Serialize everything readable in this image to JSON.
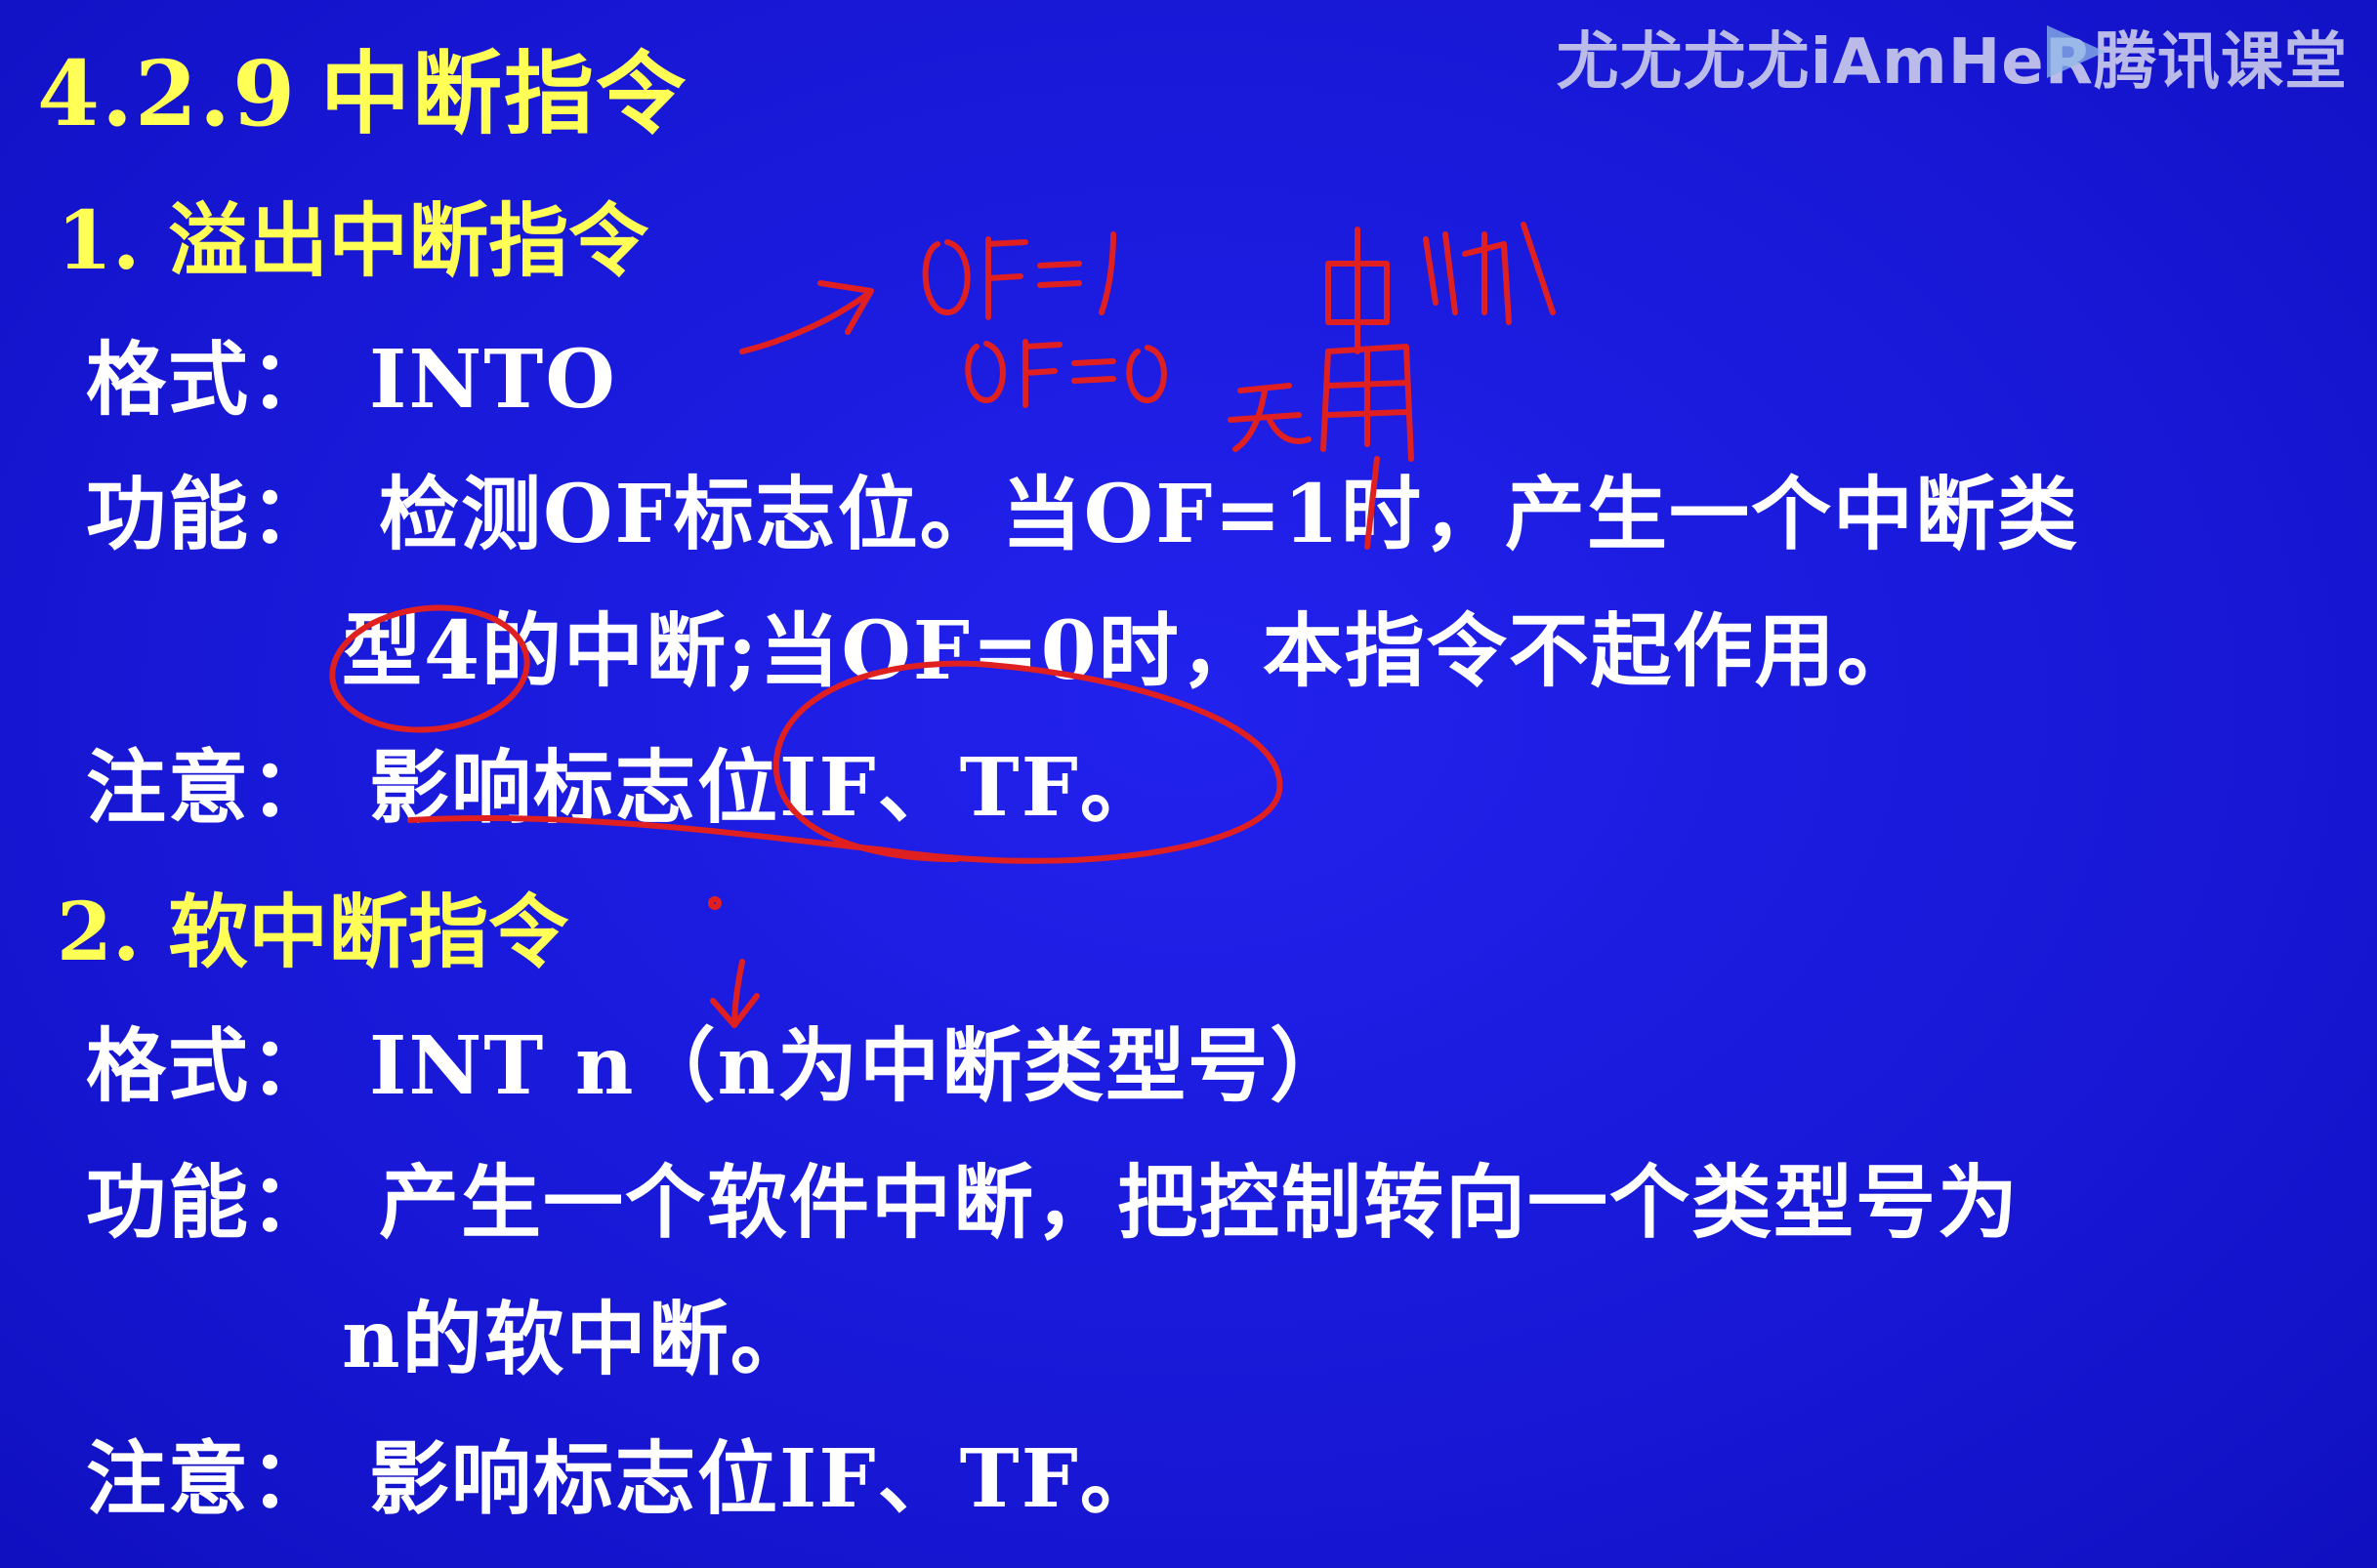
{
  "watermark": "尤尤尤尤iAmHeR腾讯课堂",
  "title": {
    "number": "4.2.9",
    "text": "中断指令"
  },
  "sec1": {
    "heading": "1.  溢出中断指令",
    "format_label": "格式：",
    "format_value": "INTO",
    "func_label": "功能：",
    "func_line1": "检测OF标志位。当OF=1时，产生一个中断类",
    "func_line2": "型4的中断;当OF=0时，本指令不起作用。",
    "note_label": "注意：",
    "note_value": "影响标志位IF、TF。"
  },
  "sec2": {
    "heading": "2. 软中断指令",
    "format_label": "格式：",
    "format_value": "INT n（n为中断类型号）",
    "func_label": "功能：",
    "func_line1": "产生一个软件中断，把控制转向一个类型号为",
    "func_line2": "n的软中断。",
    "note_label": "注意：",
    "note_value": "影响标志位IF、TF。"
  },
  "colors": {
    "background": "#1a1adf",
    "heading": "#ffff55",
    "text": "#ffffff",
    "ink": "#e02020"
  }
}
